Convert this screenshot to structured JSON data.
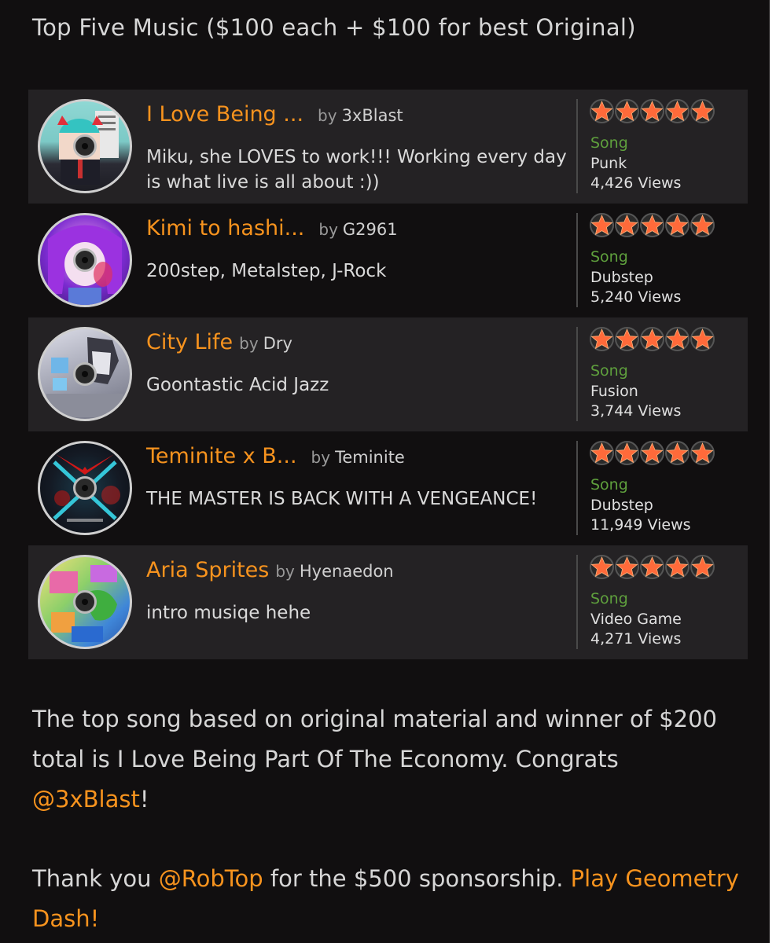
{
  "heading": "Top Five Music ($100 each + $100 for best Original)",
  "colors": {
    "background": "#110f10",
    "row_alt": "#242224",
    "accent": "#f7931e",
    "type_green": "#5fa03d",
    "star": "#ff6a3a"
  },
  "songs": [
    {
      "title": "I Love Being ...",
      "by": "by",
      "author": "3xBlast",
      "description": "Miku, she LOVES to work!!! Working every day is what live is all about :))",
      "rating": 5,
      "type": "Song",
      "genre": "Punk",
      "views": "4,426 Views",
      "thumb_icon": "miku-portrait-icon"
    },
    {
      "title": "Kimi to hashi...",
      "by": "by",
      "author": "G2961",
      "description": "200step, Metalstep, J-Rock",
      "rating": 5,
      "type": "Song",
      "genre": "Dubstep",
      "views": "5,240 Views",
      "thumb_icon": "purple-hair-girl-icon"
    },
    {
      "title": "City Life",
      "by": "by",
      "author": "Dry",
      "description": "Goontastic Acid Jazz",
      "rating": 5,
      "type": "Song",
      "genre": "Fusion",
      "views": "3,744 Views",
      "thumb_icon": "city-figure-icon"
    },
    {
      "title": "Teminite x B...",
      "by": "by",
      "author": "Teminite",
      "description": "THE MASTER IS BACK WITH A VENGEANCE!",
      "rating": 5,
      "type": "Song",
      "genre": "Dubstep",
      "views": "11,949 Views",
      "thumb_icon": "crossed-swords-icon"
    },
    {
      "title": "Aria Sprites",
      "by": "by",
      "author": "Hyenaedon",
      "description": "intro musiqe hehe",
      "rating": 5,
      "type": "Song",
      "genre": "Video Game",
      "views": "4,271 Views",
      "thumb_icon": "sprite-collage-icon"
    }
  ],
  "summary": {
    "text_before": "The top song based on original material and winner of $200 total is I Love Being Part Of The Economy. Congrats ",
    "mention": "@3xBlast",
    "text_after": "!"
  },
  "thanks": {
    "text_before": "Thank you ",
    "mention": "@RobTop",
    "text_middle": " for the $500 sponsorship. ",
    "link": "Play Geometry Dash!"
  }
}
